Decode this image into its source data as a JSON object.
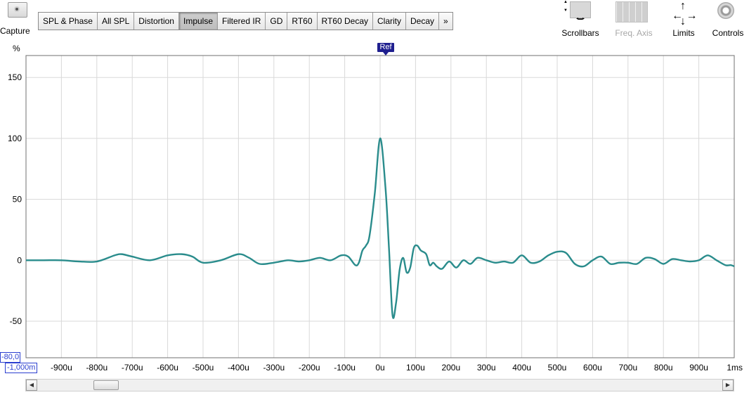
{
  "toolbar": {
    "capture_label": "Capture",
    "tabs": [
      {
        "label": "SPL & Phase"
      },
      {
        "label": "All SPL"
      },
      {
        "label": "Distortion"
      },
      {
        "label": "Impulse",
        "active": true
      },
      {
        "label": "Filtered IR"
      },
      {
        "label": "GD"
      },
      {
        "label": "RT60"
      },
      {
        "label": "RT60 Decay"
      },
      {
        "label": "Clarity"
      },
      {
        "label": "Decay"
      },
      {
        "label": "»"
      }
    ],
    "right_tools": [
      {
        "label": "Scrollbars",
        "icon": "scrollbars-icon"
      },
      {
        "label": "Freq. Axis",
        "icon": "freq-axis-icon",
        "disabled": true
      },
      {
        "label": "Limits",
        "icon": "limits-icon"
      },
      {
        "label": "Controls",
        "icon": "gear-icon"
      }
    ]
  },
  "plot": {
    "y_unit": "%",
    "ref_marker": "Ref",
    "y_min_box": "-80,0",
    "x_min_box": "-1,000m"
  },
  "chart_data": {
    "type": "line",
    "xlabel": "",
    "ylabel": "%",
    "xlim": [
      -1000,
      1000
    ],
    "ylim": [
      -80,
      168
    ],
    "grid": true,
    "line_color": "#2a8c8c",
    "y_ticks": [
      {
        "value": 150,
        "label": "150"
      },
      {
        "value": 100,
        "label": "100"
      },
      {
        "value": 50,
        "label": "50"
      },
      {
        "value": 0,
        "label": "0"
      },
      {
        "value": -50,
        "label": "-50"
      }
    ],
    "x_ticks": [
      {
        "value": -900,
        "label": "-900u"
      },
      {
        "value": -800,
        "label": "-800u"
      },
      {
        "value": -700,
        "label": "-700u"
      },
      {
        "value": -600,
        "label": "-600u"
      },
      {
        "value": -500,
        "label": "-500u"
      },
      {
        "value": -400,
        "label": "-400u"
      },
      {
        "value": -300,
        "label": "-300u"
      },
      {
        "value": -200,
        "label": "-200u"
      },
      {
        "value": -100,
        "label": "-100u"
      },
      {
        "value": 0,
        "label": "0u"
      },
      {
        "value": 100,
        "label": "100u"
      },
      {
        "value": 200,
        "label": "200u"
      },
      {
        "value": 300,
        "label": "300u"
      },
      {
        "value": 400,
        "label": "400u"
      },
      {
        "value": 500,
        "label": "500u"
      },
      {
        "value": 600,
        "label": "600u"
      },
      {
        "value": 700,
        "label": "700u"
      },
      {
        "value": 800,
        "label": "800u"
      },
      {
        "value": 900,
        "label": "900u"
      },
      {
        "value": 1000,
        "label": "1ms"
      }
    ],
    "series": [
      {
        "x": [
          -1000,
          -950,
          -900,
          -850,
          -800,
          -750,
          -730,
          -700,
          -650,
          -600,
          -560,
          -530,
          -500,
          -450,
          -400,
          -370,
          -340,
          -300,
          -260,
          -230,
          -200,
          -170,
          -140,
          -110,
          -90,
          -70,
          -60,
          -50,
          -40,
          -30,
          -15,
          0,
          15,
          25,
          35,
          45,
          55,
          65,
          75,
          85,
          95,
          105,
          115,
          130,
          140,
          150,
          160,
          175,
          195,
          215,
          235,
          255,
          275,
          300,
          325,
          350,
          375,
          400,
          425,
          450,
          475,
          500,
          525,
          550,
          575,
          600,
          625,
          650,
          675,
          700,
          725,
          750,
          775,
          800,
          825,
          850,
          875,
          900,
          925,
          950,
          975,
          990,
          1000
        ],
        "y": [
          0,
          0,
          0,
          -1,
          -1,
          4,
          5,
          3,
          0,
          4,
          5,
          3,
          -2,
          0,
          5,
          2,
          -3,
          -2,
          0,
          -1,
          0,
          2,
          0,
          4,
          3,
          -4,
          -2,
          8,
          12,
          20,
          55,
          100,
          60,
          10,
          -45,
          -35,
          -8,
          2,
          -10,
          -6,
          10,
          12,
          8,
          5,
          -4,
          -2,
          -5,
          -7,
          -1,
          -6,
          0,
          -3,
          2,
          0,
          -2,
          -1,
          -2,
          4,
          -2,
          -1,
          4,
          7,
          6,
          -3,
          -5,
          0,
          3,
          -3,
          -2,
          -2,
          -3,
          2,
          1,
          -3,
          1,
          0,
          -1,
          0,
          4,
          0,
          -4,
          -4,
          -5
        ]
      }
    ]
  }
}
